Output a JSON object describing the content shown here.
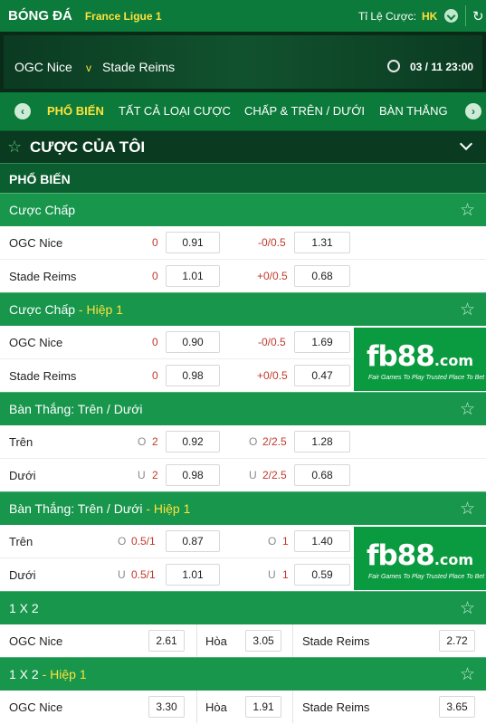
{
  "header": {
    "sport": "BÓNG ĐÁ",
    "league": "France Ligue 1",
    "odds_label": "Tỉ Lệ Cược:",
    "odds_value": "HK"
  },
  "match": {
    "home": "OGC Nice",
    "vs": "v",
    "away": "Stade Reims",
    "datetime": "03 / 11  23:00"
  },
  "tabs": [
    "PHỔ BIẾN",
    "TẤT CẢ LOẠI CƯỢC",
    "CHẤP & TRÊN / DƯỚI",
    "BÀN THẮNG"
  ],
  "my_bets": "CƯỢC CỦA TÔI",
  "popular": "PHỔ BIẾN",
  "ad": {
    "logo_main": "fb88",
    "logo_suffix": ".com",
    "tagline": "Fair Games To Play   Trusted Place To Bet"
  },
  "sections": {
    "handicap": {
      "title": "Cược Chấp",
      "rows": [
        {
          "team": "OGC Nice",
          "line1": "0",
          "odd1": "0.91",
          "line2": "-0/0.5",
          "odd2": "1.31"
        },
        {
          "team": "Stade Reims",
          "line1": "0",
          "odd1": "1.01",
          "line2": "+0/0.5",
          "odd2": "0.68"
        }
      ]
    },
    "handicap_h1": {
      "title": "Cược Chấp",
      "suffix": " - Hiệp 1",
      "rows": [
        {
          "team": "OGC Nice",
          "line1": "0",
          "odd1": "0.90",
          "line2": "-0/0.5",
          "odd2": "1.69"
        },
        {
          "team": "Stade Reims",
          "line1": "0",
          "odd1": "0.98",
          "line2": "+0/0.5",
          "odd2": "0.47"
        }
      ]
    },
    "ou": {
      "title": "Bàn Thắng: Trên / Dưới",
      "rows": [
        {
          "team": "Trên",
          "pre1": "O",
          "line1": "2",
          "odd1": "0.92",
          "pre2": "O",
          "line2": "2/2.5",
          "odd2": "1.28"
        },
        {
          "team": "Dưới",
          "pre1": "U",
          "line1": "2",
          "odd1": "0.98",
          "pre2": "U",
          "line2": "2/2.5",
          "odd2": "0.68"
        }
      ]
    },
    "ou_h1": {
      "title": "Bàn Thắng: Trên / Dưới",
      "suffix": " - Hiệp 1",
      "rows": [
        {
          "team": "Trên",
          "pre1": "O",
          "line1": "0.5/1",
          "odd1": "0.87",
          "pre2": "O",
          "line2": "1",
          "odd2": "1.40"
        },
        {
          "team": "Dưới",
          "pre1": "U",
          "line1": "0.5/1",
          "odd1": "1.01",
          "pre2": "U",
          "line2": "1",
          "odd2": "0.59"
        }
      ]
    },
    "x12": {
      "title": "1 X 2",
      "home": "OGC Nice",
      "home_odd": "2.61",
      "draw": "Hòa",
      "draw_odd": "3.05",
      "away": "Stade Reims",
      "away_odd": "2.72"
    },
    "x12_h1": {
      "title": "1 X 2",
      "suffix": " - Hiệp 1",
      "home": "OGC Nice",
      "home_odd": "3.30",
      "draw": "Hòa",
      "draw_odd": "1.91",
      "away": "Stade Reims",
      "away_odd": "3.65"
    }
  }
}
